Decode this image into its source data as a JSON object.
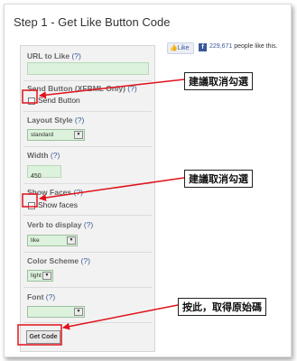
{
  "header": {
    "title": "Step 1 - Get Like Button Code"
  },
  "form": {
    "help": "(?)",
    "url_label": "URL to Like",
    "url_value": "",
    "send_label": "Send Button (XFBML Only)",
    "send_checkbox_label": "Send Button",
    "send_checked": false,
    "layout_label": "Layout Style",
    "layout_value": "standard",
    "width_label": "Width",
    "width_value": "450",
    "faces_label": "Show Faces",
    "faces_checkbox_label": "Show faces",
    "faces_checked": false,
    "verb_label": "Verb to display",
    "verb_value": "like",
    "scheme_label": "Color Scheme",
    "scheme_value": "light",
    "font_label": "Font",
    "font_value": "",
    "dropdown_arrow": "▼",
    "submit_label": "Get Code"
  },
  "preview": {
    "like_label": "Like",
    "fb_letter": "f",
    "count": "229,671",
    "count_suffix": " people like this."
  },
  "callouts": {
    "send": "建議取消勾選",
    "faces": "建議取消勾選",
    "getcode": "按此，取得原始碼"
  },
  "colors": {
    "annotation_red": "#e0121a",
    "facebook_blue": "#3b5998",
    "input_green": "#dcf2dc"
  }
}
